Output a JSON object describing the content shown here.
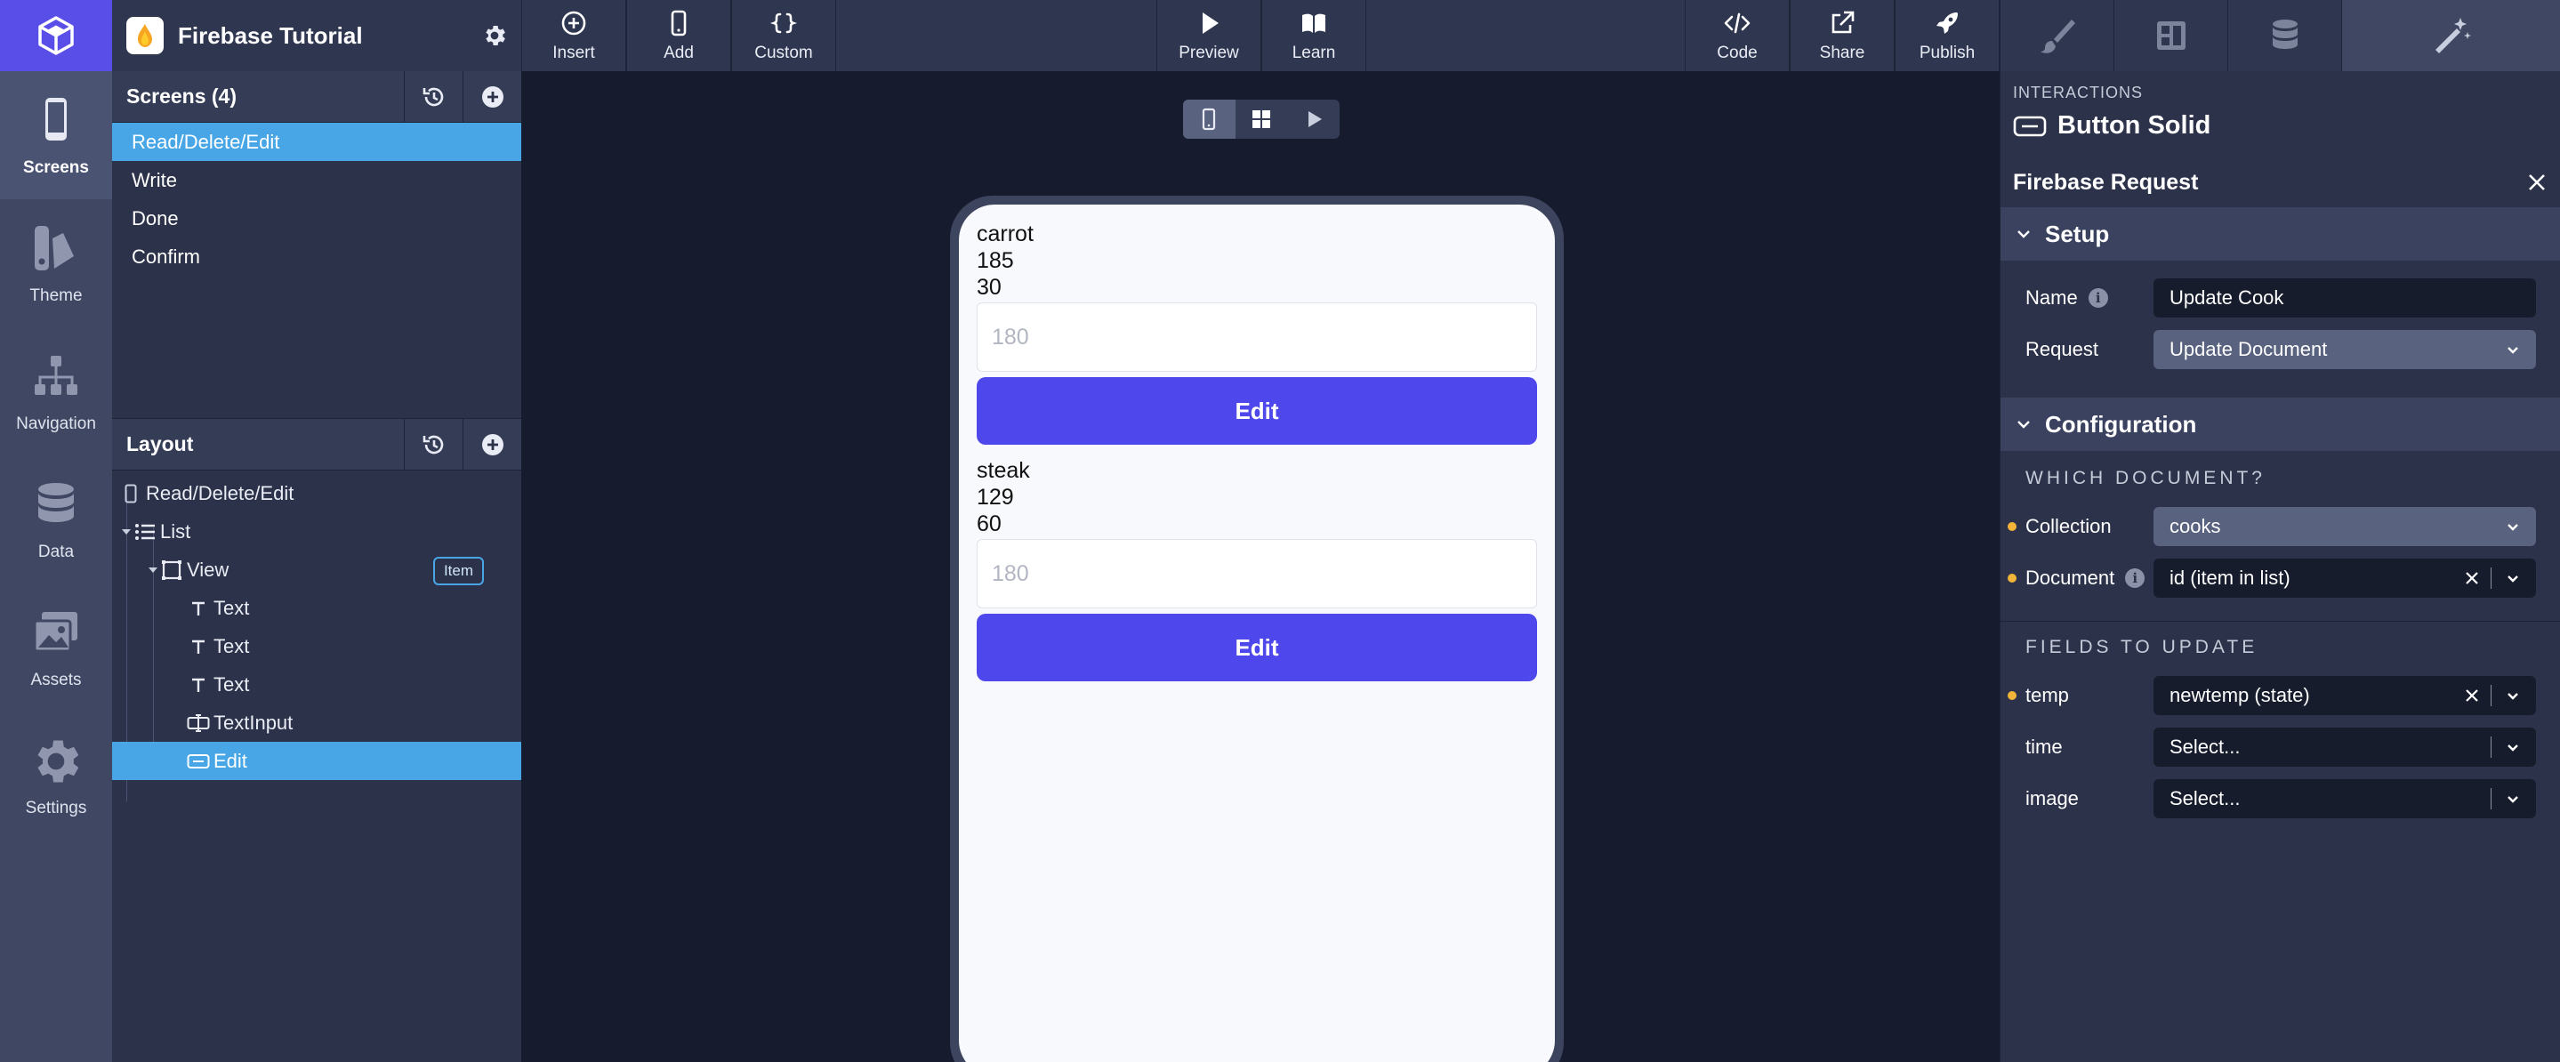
{
  "app": {
    "project_name": "Firebase Tutorial"
  },
  "toolbar": {
    "insert": "Insert",
    "add": "Add",
    "custom": "Custom",
    "preview": "Preview",
    "learn": "Learn",
    "code": "Code",
    "share": "Share",
    "publish": "Publish"
  },
  "rail": {
    "screens": "Screens",
    "theme": "Theme",
    "navigation": "Navigation",
    "data": "Data",
    "assets": "Assets",
    "settings": "Settings"
  },
  "screens_panel": {
    "title": "Screens (4)",
    "items": [
      {
        "label": "Read/Delete/Edit"
      },
      {
        "label": "Write"
      },
      {
        "label": "Done"
      },
      {
        "label": "Confirm"
      }
    ]
  },
  "layout_panel": {
    "title": "Layout",
    "tree": [
      {
        "label": "Read/Delete/Edit"
      },
      {
        "label": "List"
      },
      {
        "label": "View"
      },
      {
        "label": "Text"
      },
      {
        "label": "Text"
      },
      {
        "label": "Text"
      },
      {
        "label": "TextInput"
      },
      {
        "label": "Edit"
      }
    ],
    "item_badge": "Item"
  },
  "canvas": {
    "cooks": [
      {
        "name": "carrot",
        "temp": "185",
        "time": "30",
        "input_placeholder": "180",
        "button_label": "Edit"
      },
      {
        "name": "steak",
        "temp": "129",
        "time": "60",
        "input_placeholder": "180",
        "button_label": "Edit"
      }
    ]
  },
  "interactions": {
    "section_label": "INTERACTIONS",
    "component": "Button Solid",
    "request_title": "Firebase Request",
    "setup": {
      "title": "Setup",
      "name_label": "Name",
      "name_value": "Update Cook",
      "request_label": "Request",
      "request_value": "Update Document"
    },
    "configuration": {
      "title": "Configuration",
      "which_document": "WHICH DOCUMENT?",
      "collection_label": "Collection",
      "collection_value": "cooks",
      "document_label": "Document",
      "document_value": "id (item in list)",
      "fields_to_update": "FIELDS TO UPDATE",
      "fields": [
        {
          "label": "temp",
          "value": "newtemp (state)"
        },
        {
          "label": "time",
          "value": "Select..."
        },
        {
          "label": "image",
          "value": "Select..."
        }
      ]
    }
  },
  "colors": {
    "accent": "#5a4ee8",
    "selection": "#48a6e6",
    "button": "#4e47ec",
    "required_dot": "#f2b53a"
  }
}
